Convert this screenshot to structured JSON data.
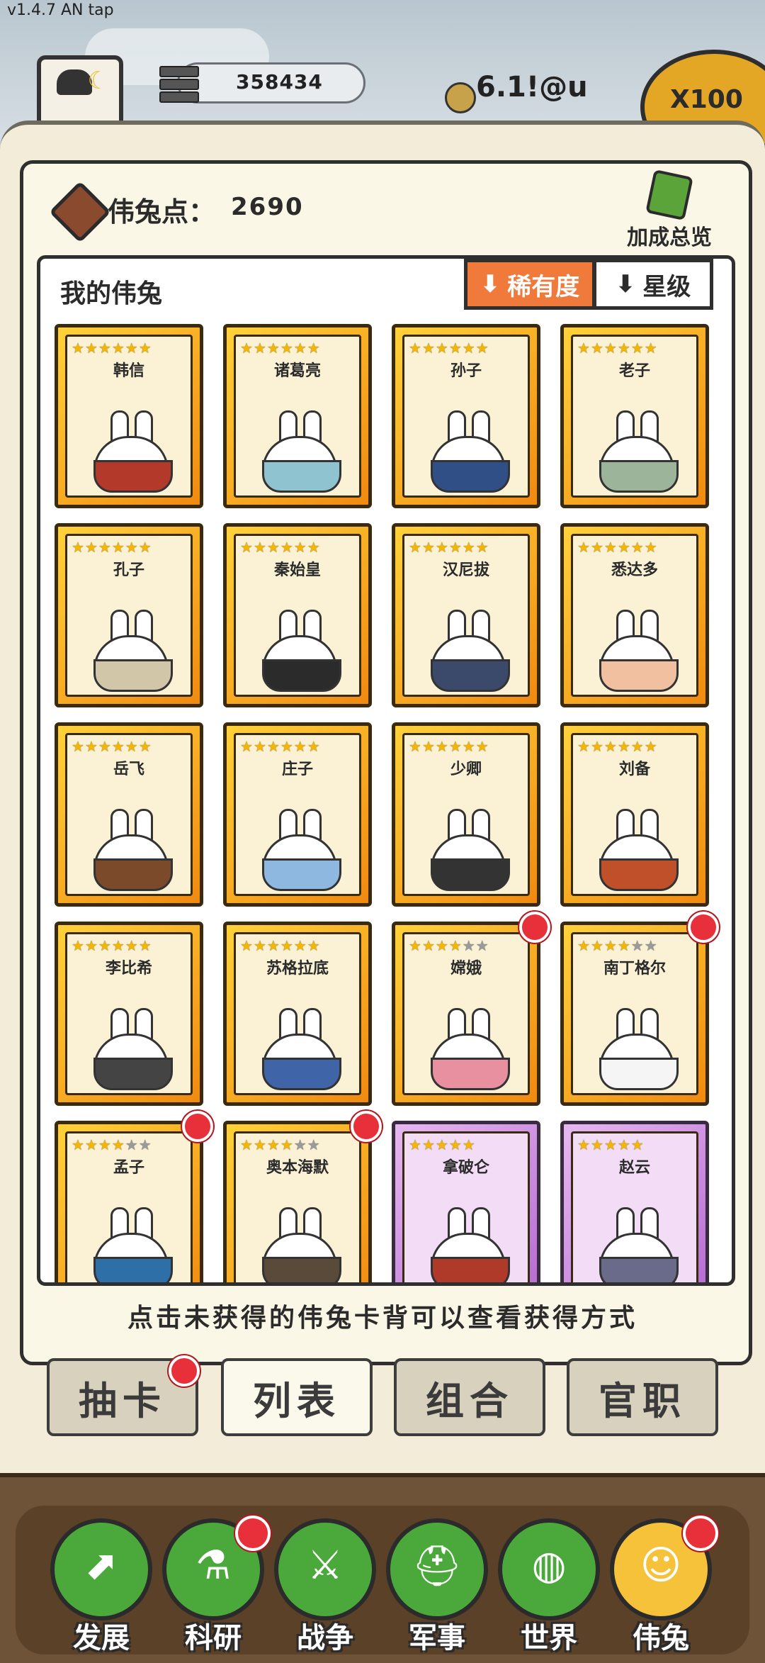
{
  "version": "v1.4.7 AN tap",
  "header": {
    "resource_value": "358434",
    "coin_value": "6.1!@u",
    "multiplier": "X100"
  },
  "points": {
    "label": "伟兔点：",
    "value": "2690"
  },
  "bonus_overview": "加成总览",
  "collection": {
    "title": "我的伟兔",
    "sort_rarity": "稀有度",
    "sort_star": "星级",
    "cards": [
      {
        "name": "韩信",
        "stars": 6,
        "max": 6,
        "frame": "gold"
      },
      {
        "name": "诸葛亮",
        "stars": 6,
        "max": 6,
        "frame": "gold"
      },
      {
        "name": "孙子",
        "stars": 6,
        "max": 6,
        "frame": "gold"
      },
      {
        "name": "老子",
        "stars": 6,
        "max": 6,
        "frame": "gold"
      },
      {
        "name": "孔子",
        "stars": 6,
        "max": 6,
        "frame": "gold"
      },
      {
        "name": "秦始皇",
        "stars": 6,
        "max": 6,
        "frame": "gold"
      },
      {
        "name": "汉尼拔",
        "stars": 6,
        "max": 6,
        "frame": "gold"
      },
      {
        "name": "悉达多",
        "stars": 6,
        "max": 6,
        "frame": "gold"
      },
      {
        "name": "岳飞",
        "stars": 6,
        "max": 6,
        "frame": "gold"
      },
      {
        "name": "庄子",
        "stars": 6,
        "max": 6,
        "frame": "gold"
      },
      {
        "name": "少卿",
        "stars": 6,
        "max": 6,
        "frame": "gold"
      },
      {
        "name": "刘备",
        "stars": 6,
        "max": 6,
        "frame": "gold"
      },
      {
        "name": "李比希",
        "stars": 6,
        "max": 6,
        "frame": "gold"
      },
      {
        "name": "苏格拉底",
        "stars": 6,
        "max": 6,
        "frame": "gold"
      },
      {
        "name": "嫦娥",
        "stars": 4,
        "max": 6,
        "frame": "gold",
        "badge": true
      },
      {
        "name": "南丁格尔",
        "stars": 4,
        "max": 6,
        "frame": "gold",
        "badge": true
      },
      {
        "name": "孟子",
        "stars": 4,
        "max": 6,
        "frame": "gold",
        "badge": true
      },
      {
        "name": "奥本海默",
        "stars": 4,
        "max": 6,
        "frame": "gold",
        "badge": true
      },
      {
        "name": "拿破仑",
        "stars": 5,
        "max": 5,
        "frame": "purple"
      },
      {
        "name": "赵云",
        "stars": 5,
        "max": 5,
        "frame": "purple"
      }
    ]
  },
  "hint": "点击未获得的伟兔卡背可以查看获得方式",
  "tabs": [
    {
      "label": "抽卡",
      "badge": true
    },
    {
      "label": "列表",
      "active": true
    },
    {
      "label": "组合"
    },
    {
      "label": "官职"
    }
  ],
  "nav": [
    {
      "label": "发展",
      "icon": "mushroom-icon",
      "glyph": "⬈"
    },
    {
      "label": "科研",
      "icon": "flask-icon",
      "glyph": "⚗",
      "badge": true
    },
    {
      "label": "战争",
      "icon": "crossed-swords-icon",
      "glyph": "⚔"
    },
    {
      "label": "军事",
      "icon": "helmet-icon",
      "glyph": "⛑"
    },
    {
      "label": "世界",
      "icon": "globe-icon",
      "glyph": "◍"
    },
    {
      "label": "伟兔",
      "icon": "rabbit-card-icon",
      "glyph": "☺",
      "badge": true,
      "active": true
    }
  ],
  "colors": {
    "accent_orange": "#f07a3c",
    "gold": "#f5b600",
    "green": "#4aa93a",
    "badge_red": "#e8303a"
  }
}
